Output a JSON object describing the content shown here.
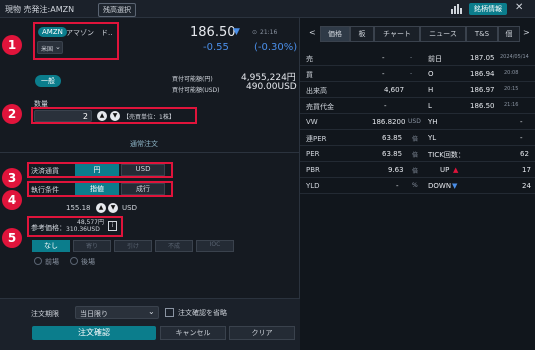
{
  "topbar": {
    "title": "現物 売発注:AMZN",
    "holding_button": "残高選択",
    "stock_info_button": "銘柄情報",
    "close_label": "✕"
  },
  "symbol": {
    "ticker": "AMZN",
    "name": "アマゾン",
    "name_suffix": "ド..",
    "market": "米国",
    "price": "186.50",
    "time": "21:16",
    "change": "-0.55",
    "change_pct": "(-0.30%)"
  },
  "account": {
    "type": "一般",
    "buying_power_label": "買付可能額(円)",
    "buying_power_value": "4,955,224円",
    "buying_power_usd_label": "買付可能額(USD)",
    "buying_power_usd_value": "490.00USD"
  },
  "quantity": {
    "label": "数量",
    "value": "2",
    "unit_note": "【売買単位：1株】"
  },
  "order_type_tab": "通常注文",
  "settlement": {
    "label": "決済通貨",
    "options": [
      "円",
      "USD"
    ]
  },
  "execution": {
    "label": "執行条件",
    "options": [
      "指値",
      "成行"
    ],
    "price": "155.18",
    "price_unit": "USD"
  },
  "reference": {
    "label": "参考価格：",
    "yen": "48,577円",
    "usd": "310.36USD"
  },
  "conditions": {
    "options": [
      "なし",
      "寄り",
      "引け",
      "不成",
      "IOC"
    ],
    "radio1": "前場",
    "radio2": "後場"
  },
  "bottom": {
    "expiry_label": "注文期限",
    "expiry_value": "当日限り",
    "skip_confirm": "注文確認を省略",
    "confirm": "注文確認",
    "cancel": "キャンセル",
    "clear": "クリア"
  },
  "badges": [
    "1",
    "2",
    "3",
    "4",
    "5"
  ],
  "tabs": [
    "価格",
    "板",
    "チャート",
    "ニュース",
    "T&S",
    "個"
  ],
  "nav": {
    "prev": "<",
    "next": ">"
  },
  "rows": [
    {
      "l": "売",
      "lv": "-",
      "lunit": "-",
      "r": "前日",
      "rv": "187.05",
      "rsub": "2024/05/14"
    },
    {
      "l": "買",
      "lv": "-",
      "lunit": "-",
      "r": "O",
      "rv": "186.94",
      "rsub": "20:08"
    },
    {
      "l": "出来高",
      "lv": "4,607",
      "lunit": "",
      "r": "H",
      "rv": "186.97",
      "rsub": "20:15"
    },
    {
      "l": "売買代金",
      "lv": "-",
      "lunit": "",
      "r": "L",
      "rv": "186.50",
      "rsub": "21:16"
    },
    {
      "l": "VW",
      "lv": "186.8200",
      "lunit": "USD",
      "r": "YH",
      "rv": "-",
      "rsub": ""
    },
    {
      "l": "連PER",
      "lv": "63.85",
      "lunit": "倍",
      "r": "YL",
      "rv": "-",
      "rsub": ""
    },
    {
      "l": "PER",
      "lv": "63.85",
      "lunit": "倍",
      "r": "TICK回数：",
      "rv": "62",
      "rsub": ""
    },
    {
      "l": "PBR",
      "lv": "9.63",
      "lunit": "倍",
      "r": "UP",
      "rv": "17",
      "rsub": ""
    },
    {
      "l": "YLD",
      "lv": "-",
      "lunit": "%",
      "r": "DOWN",
      "rv": "24",
      "rsub": ""
    }
  ]
}
